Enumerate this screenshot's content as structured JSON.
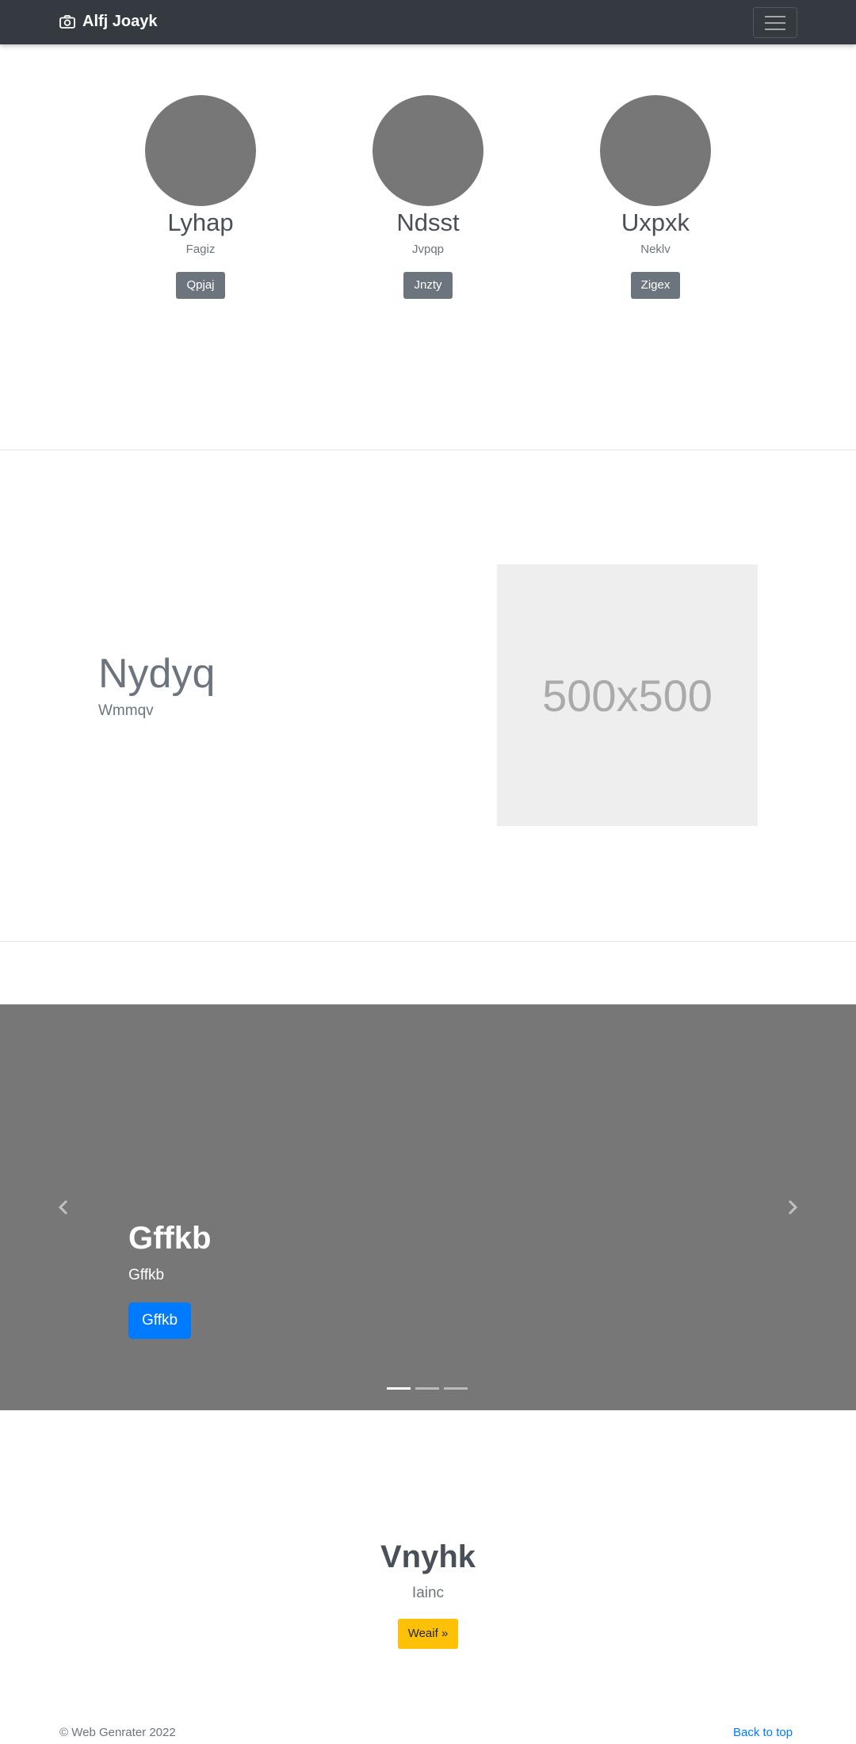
{
  "navbar": {
    "brand": "Alfj Joayk",
    "brand_icon": "camera-icon",
    "toggler_icon": "hamburger-icon"
  },
  "team": [
    {
      "name": "Lyhap",
      "subtitle": "Fagiz",
      "button": "Qpjaj"
    },
    {
      "name": "Ndsst",
      "subtitle": "Jvpqp",
      "button": "Jnzty"
    },
    {
      "name": "Uxpxk",
      "subtitle": "Neklv",
      "button": "Zigex"
    }
  ],
  "feature": {
    "title": "Nydyq",
    "subtitle": "Wmmqv",
    "image_text": "500x500"
  },
  "carousel": {
    "title": "Gffkb",
    "subtitle": "Gffkb",
    "button": "Gffkb",
    "slide_count": 3,
    "active_slide": 1,
    "prev_icon": "chevron-left-icon",
    "next_icon": "chevron-right-icon"
  },
  "cta": {
    "title": "Vnyhk",
    "subtitle": "Iainc",
    "button": "Weaif »"
  },
  "footer": {
    "copyright": "© Web Genrater 2022",
    "back_to_top": "Back to top"
  },
  "colors": {
    "navbar": "#343a40",
    "primary": "#007bff",
    "secondary": "#6c757d",
    "warning": "#ffc107",
    "carousel_bg": "#777777"
  }
}
